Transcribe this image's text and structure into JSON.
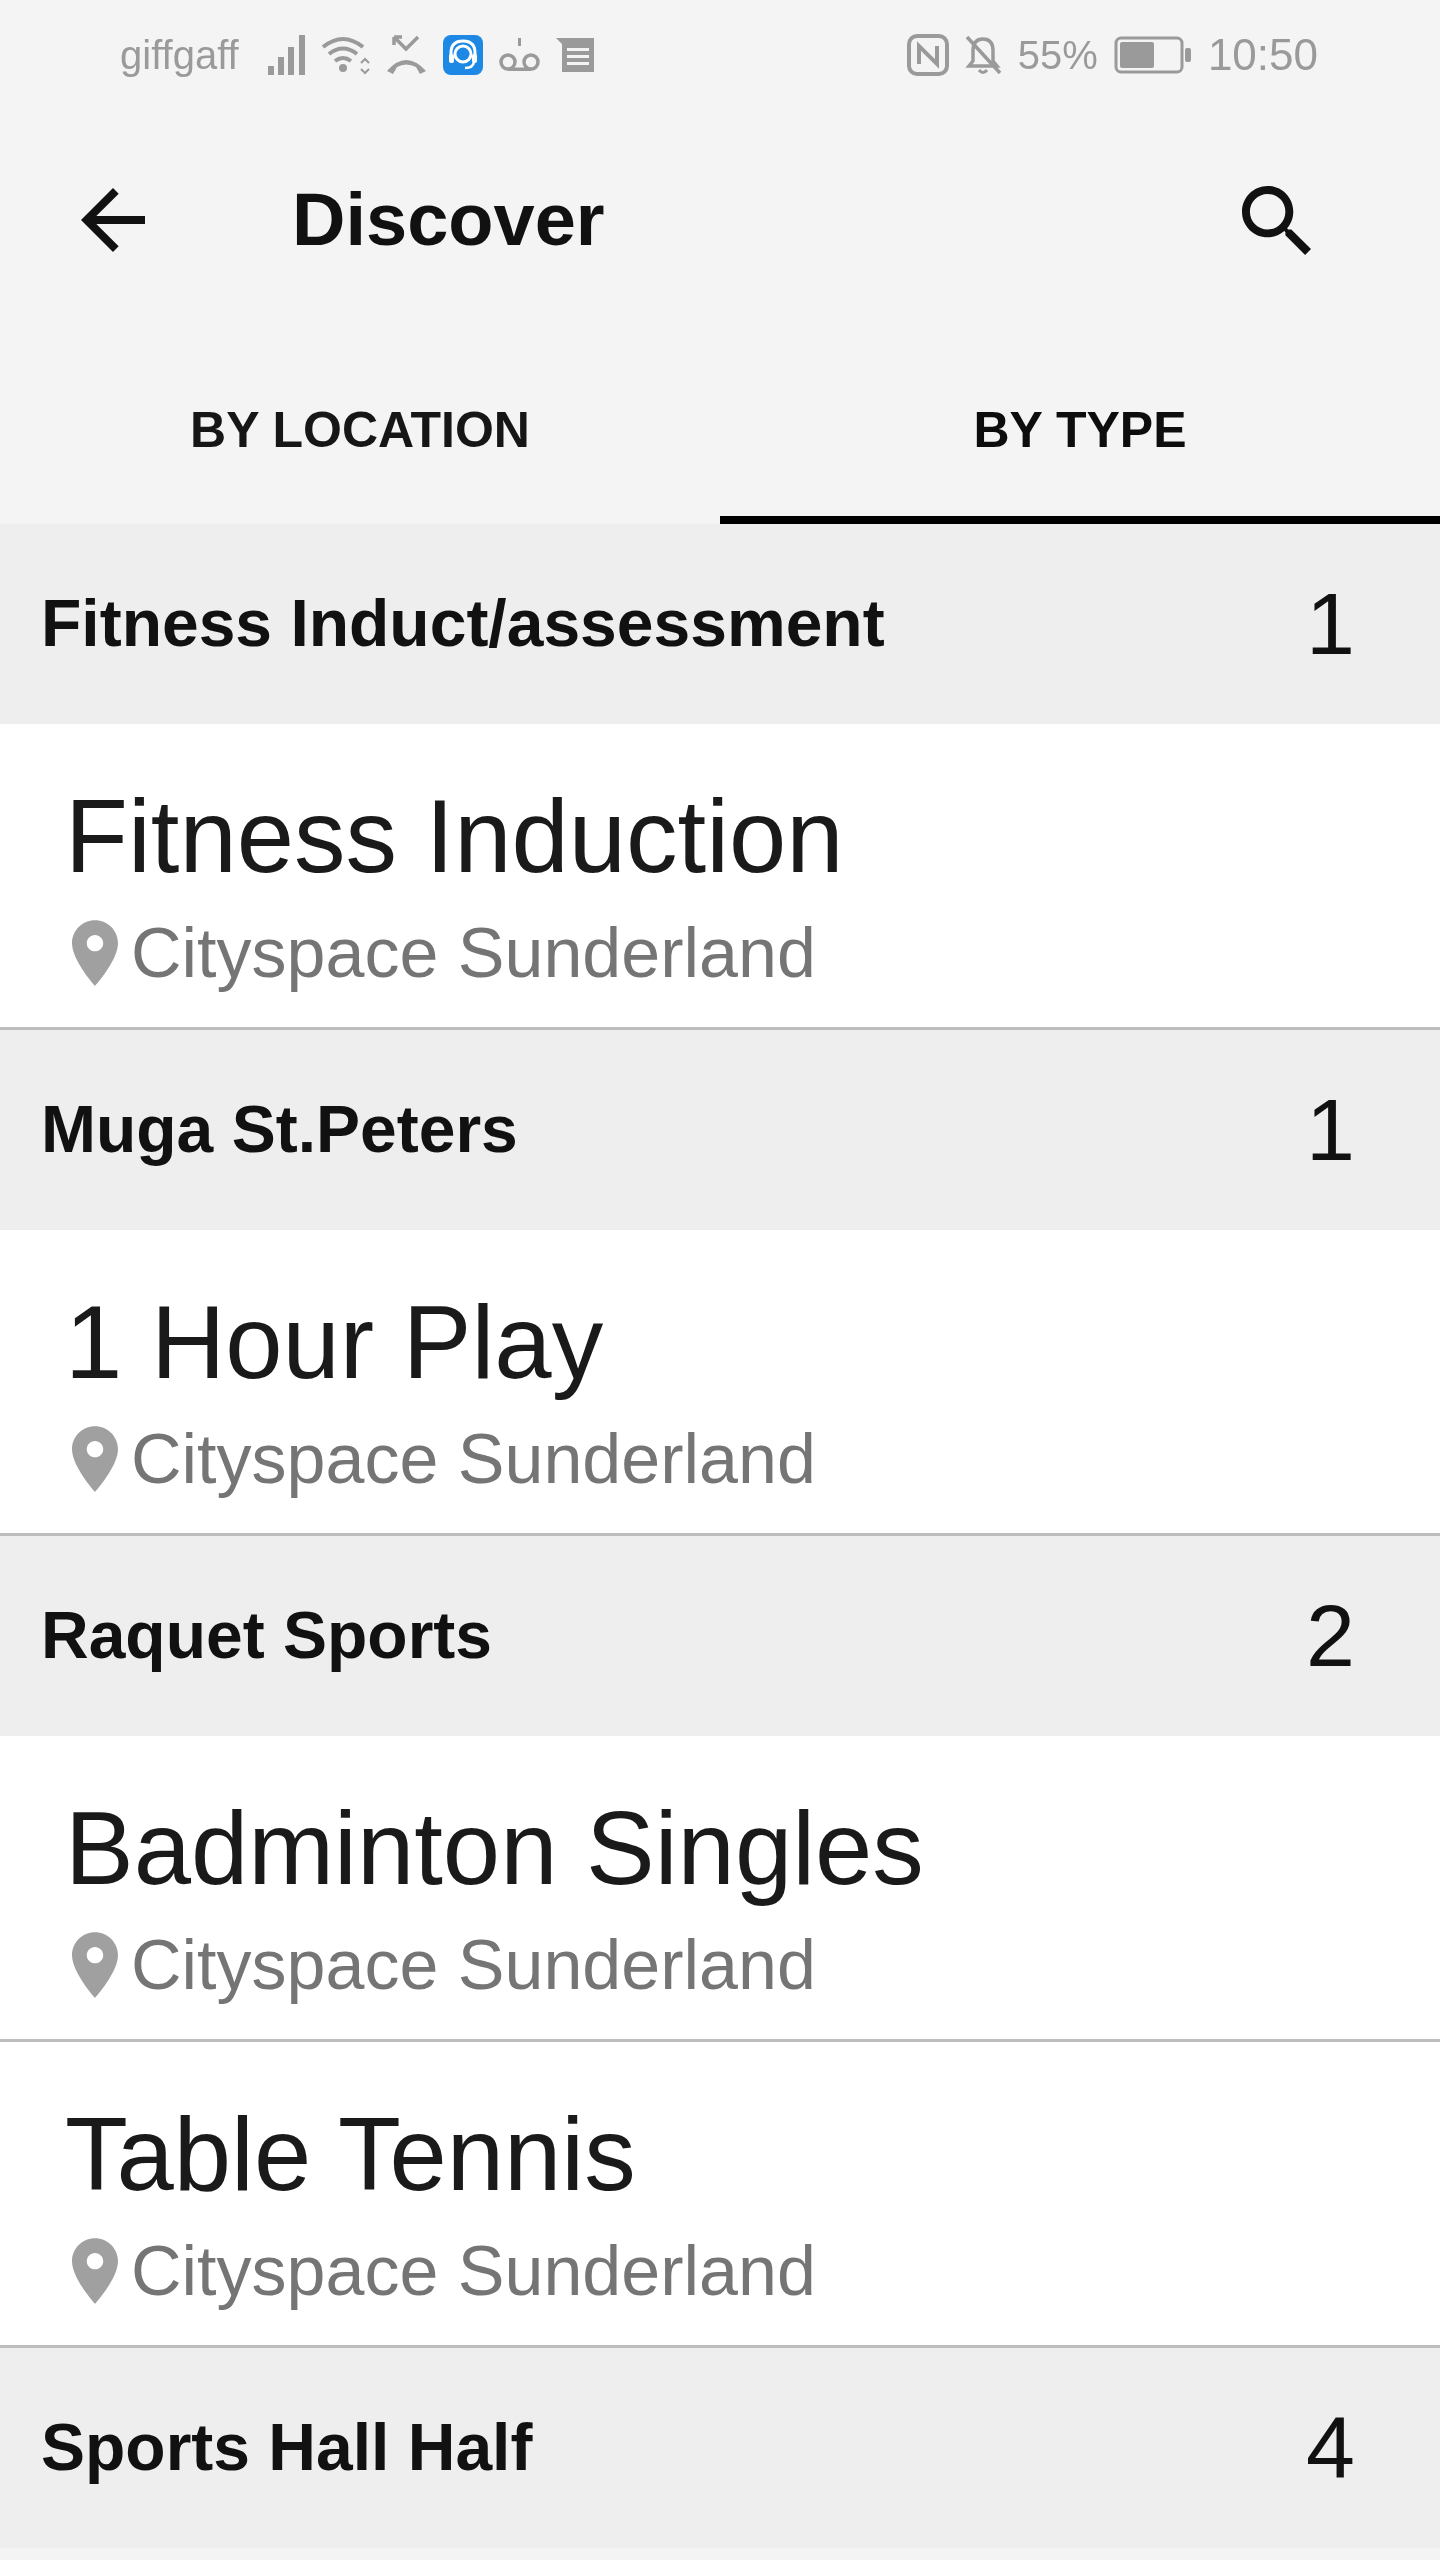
{
  "status_bar": {
    "carrier": "giffgaff",
    "battery": "55%",
    "time": "10:50"
  },
  "toolbar": {
    "title": "Discover"
  },
  "tabs": [
    {
      "label": "BY LOCATION",
      "selected": false
    },
    {
      "label": "BY TYPE",
      "selected": true
    }
  ],
  "groups": [
    {
      "name": "Fitness Induct/assessment",
      "count": "1",
      "items": [
        {
          "title": "Fitness Induction",
          "location": "Cityspace Sunderland"
        }
      ]
    },
    {
      "name": "Muga St.Peters",
      "count": "1",
      "items": [
        {
          "title": "1 Hour Play",
          "location": "Cityspace Sunderland"
        }
      ]
    },
    {
      "name": "Raquet Sports",
      "count": "2",
      "items": [
        {
          "title": "Badminton Singles",
          "location": "Cityspace Sunderland"
        },
        {
          "title": "Table Tennis",
          "location": "Cityspace Sunderland"
        }
      ]
    },
    {
      "name": "Sports Hall Half",
      "count": "4"
    }
  ]
}
